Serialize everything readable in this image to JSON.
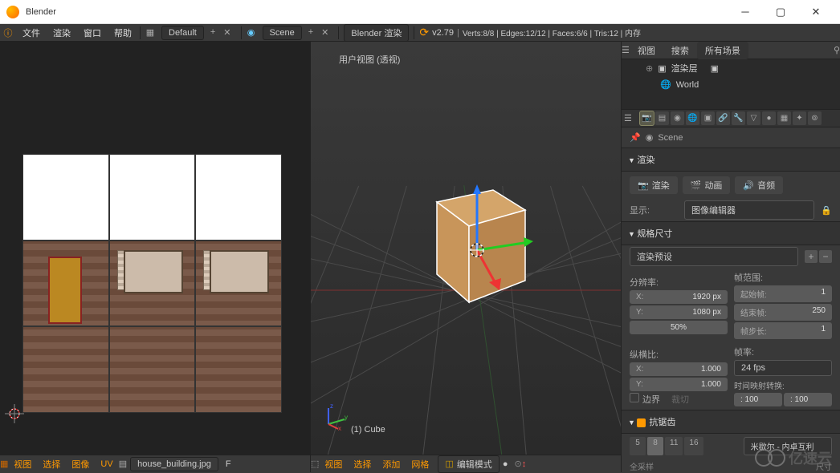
{
  "title": "Blender",
  "topmenu": {
    "file": "文件",
    "render": "渲染",
    "window": "窗口",
    "help": "帮助"
  },
  "layout": "Default",
  "scene_field": "Scene",
  "engine": "Blender 渲染",
  "version": "v2.79",
  "stats": "Verts:8/8 | Edges:12/12 | Faces:6/6 | Tris:12 | 内存",
  "viewport": {
    "label": "用户视图 (透视)",
    "object": "(1) Cube"
  },
  "uv_footer": {
    "view": "视图",
    "select": "选择",
    "image": "图像",
    "uvs": "UV",
    "filename": "house_building.jpg",
    "f_label": "F"
  },
  "view3d_footer": {
    "view": "视图",
    "select": "选择",
    "add": "添加",
    "mesh": "网格",
    "mode": "编辑模式"
  },
  "outliner": {
    "tabs": {
      "view": "视图",
      "search": "搜索",
      "all": "所有场景"
    },
    "row1": "渲染层",
    "row2": "World"
  },
  "scene_crumb": "Scene",
  "props": {
    "sec_render": "渲染",
    "render_btn": "渲染",
    "anim_btn": "动画",
    "audio_btn": "音频",
    "display_label": "显示:",
    "display_value": "图像编辑器",
    "sec_dims": "规格尺寸",
    "preset": "渲染预设",
    "res_label": "分辨率:",
    "res_x_l": "X:",
    "res_x_v": "1920 px",
    "res_y_l": "Y:",
    "res_y_v": "1080 px",
    "res_pct": "50%",
    "frange_label": "帧范围:",
    "fstart_l": "起始帧:",
    "fstart_v": "1",
    "fend_l": "结束帧:",
    "fend_v": "250",
    "fstep_l": "帧步长:",
    "fstep_v": "1",
    "aspect_label": "纵横比:",
    "asp_x_l": "X:",
    "asp_x_v": "1.000",
    "asp_y_l": "Y:",
    "asp_y_v": "1.000",
    "fps_label": "帧率:",
    "fps_value": "24 fps",
    "remap_label": "时间映射转换:",
    "remap_old": ": 100",
    "remap_new": ": 100",
    "border_label": "边界",
    "crop_label": "裁切",
    "size_label": "尺寸",
    "sec_aa": "抗锯齿",
    "samples": [
      "5",
      "8",
      "11",
      "16"
    ],
    "samples_active": "8",
    "aa_filter": "米歇尔 - 内卓互利",
    "full_sample": "全采样"
  },
  "watermark": "亿速云"
}
